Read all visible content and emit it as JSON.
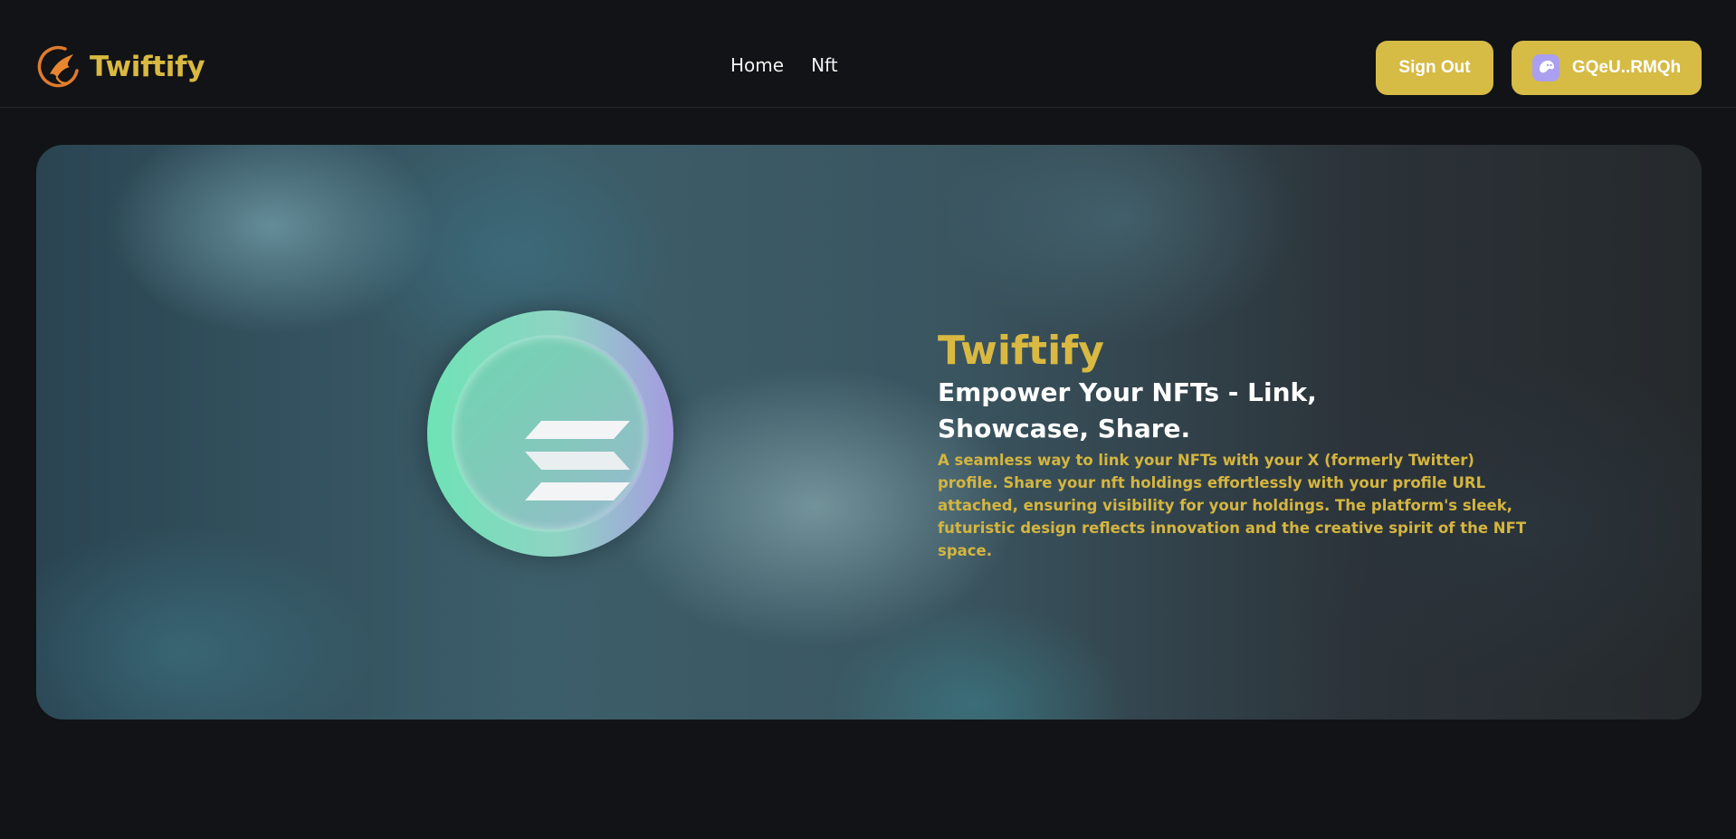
{
  "navbar": {
    "brand_name": "Twiftify",
    "links": [
      {
        "label": "Home"
      },
      {
        "label": "Nft"
      }
    ],
    "sign_out_label": "Sign Out",
    "wallet_label": "GQeU..RMQh"
  },
  "hero": {
    "title": "Twiftify",
    "subtitle": "Empower Your NFTs - Link, Showcase, Share.",
    "description": "A seamless way to link your NFTs with your X (formerly Twitter) profile. Share your nft holdings effortlessly with your profile URL attached, ensuring visibility for your holdings. The platform's sleek, futuristic design reflects innovation and the creative spirit of the NFT space."
  },
  "colors": {
    "background": "#121316",
    "accent_gold": "#d6bb45",
    "wallet_icon": "#ab9ff2"
  },
  "icons": {
    "brand": "phoenix-logo-icon",
    "wallet": "phantom-ghost-icon",
    "coin": "solana-coin-icon"
  }
}
